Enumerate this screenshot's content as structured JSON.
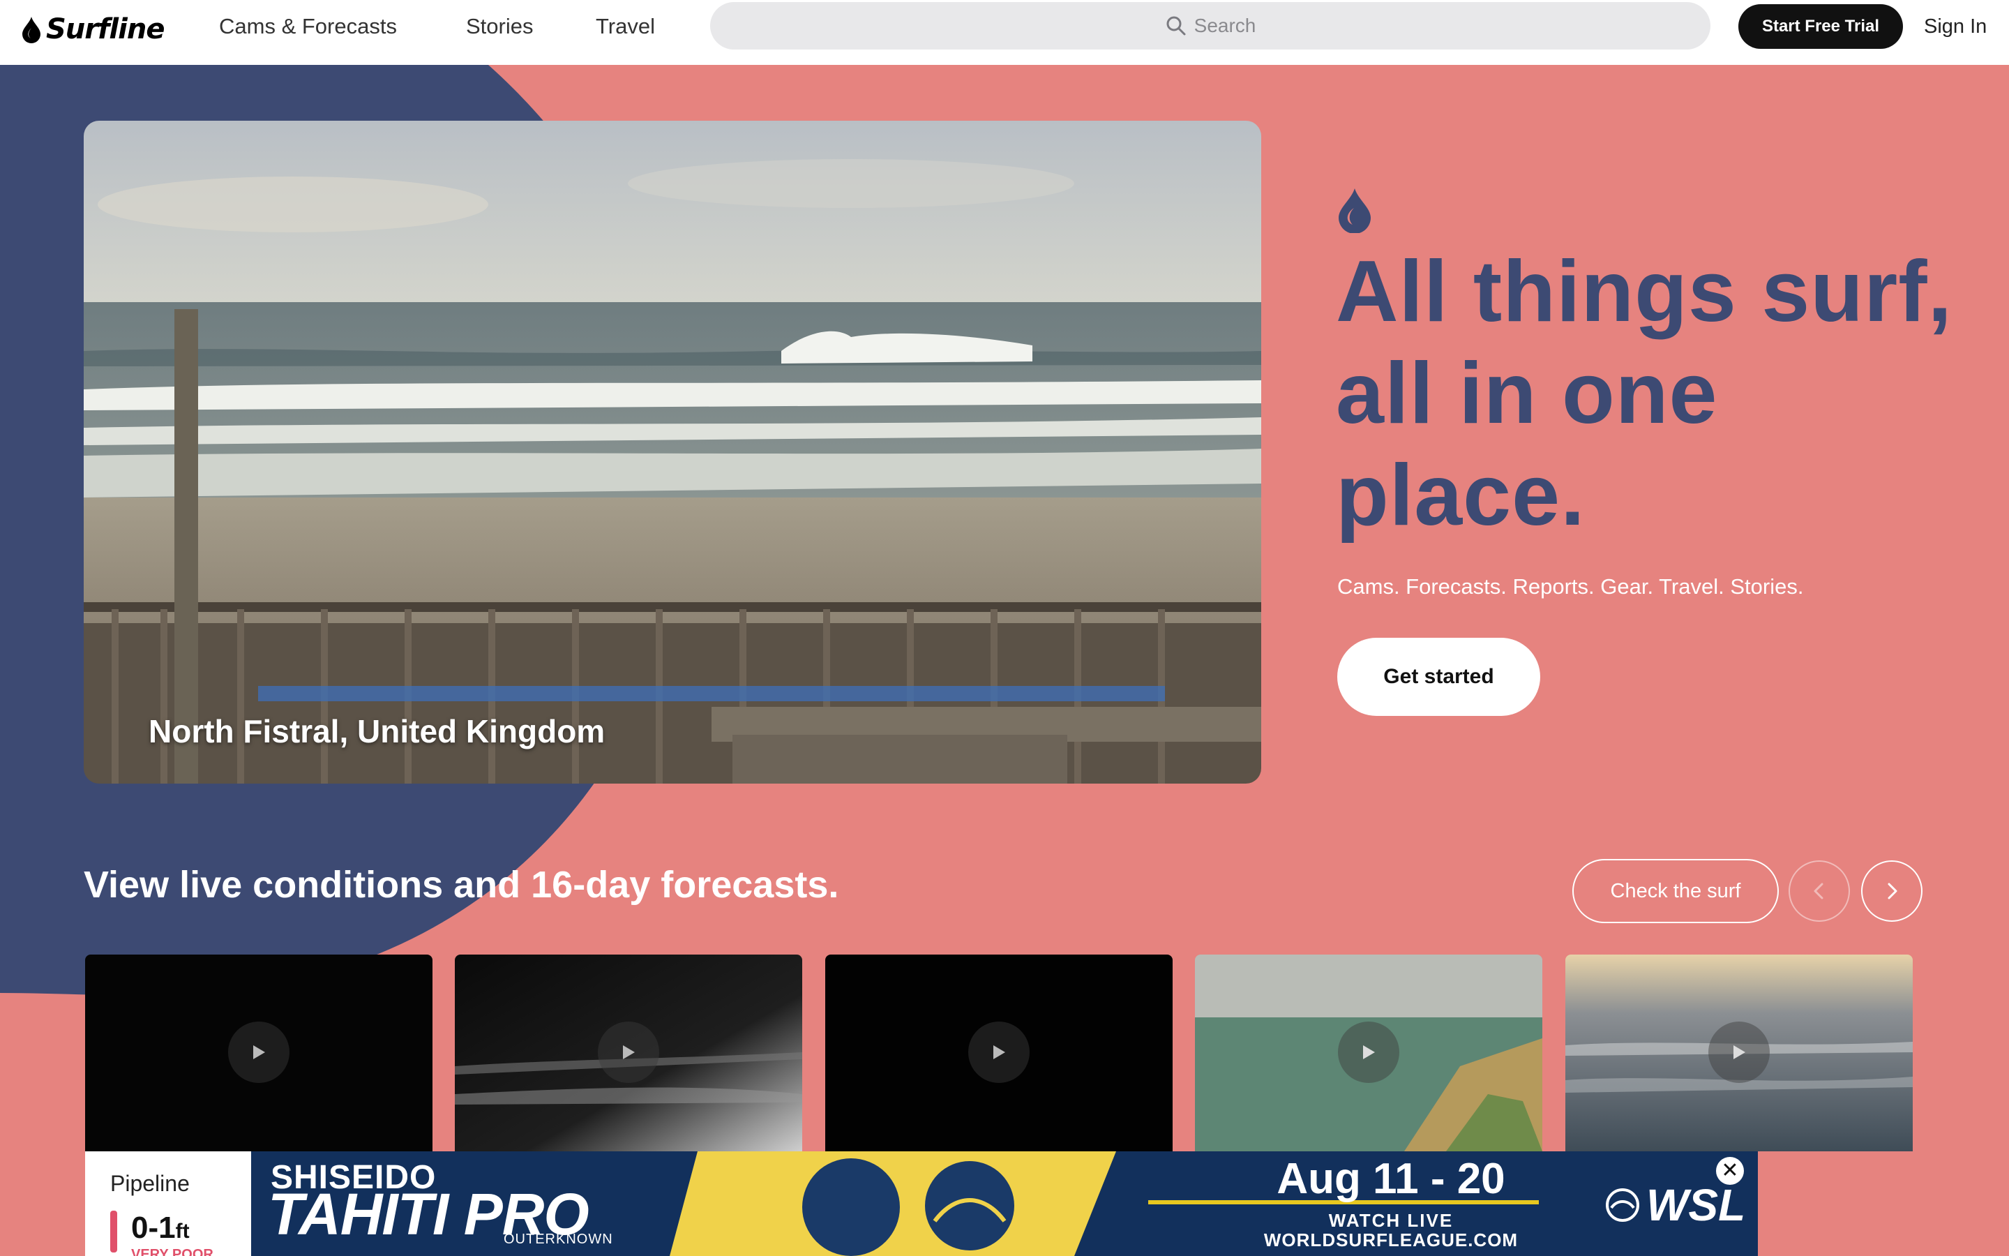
{
  "brand": {
    "name": "Surfline"
  },
  "nav": {
    "items": [
      {
        "label": "Cams & Forecasts"
      },
      {
        "label": "Stories"
      },
      {
        "label": "Travel"
      }
    ]
  },
  "search": {
    "placeholder": "Search"
  },
  "header": {
    "trial_label": "Start Free Trial",
    "signin_label": "Sign In"
  },
  "hero": {
    "caption": "North Fistral, United Kingdom",
    "heading": "All things surf, all in one place.",
    "subheading": "Cams. Forecasts. Reports. Gear. Travel. Stories.",
    "cta_label": "Get started"
  },
  "conditions": {
    "title": "View live conditions and 16-day forecasts.",
    "check_label": "Check the surf",
    "cams": [
      {
        "name": "Pipeline",
        "height": "0-1",
        "unit": "ft",
        "rating": "VERY POOR",
        "icon": "play-icon"
      },
      {
        "icon": "play-icon"
      },
      {
        "icon": "play-icon"
      },
      {
        "icon": "play-icon"
      },
      {
        "icon": "play-icon"
      }
    ]
  },
  "ad": {
    "sponsor": "SHISEIDO",
    "event": "TAHITI PRO",
    "presenter": "OUTERKNOWN",
    "dates": "Aug 11 - 20",
    "watch": "WATCH LIVE",
    "url": "WORLDSURFLEAGUE.COM",
    "org": "WSL",
    "close_label": "✕"
  },
  "colors": {
    "background": "#e6837f",
    "navy": "#3d4a73",
    "accent_pink": "#e0506a",
    "ad_navy": "#12305c"
  }
}
